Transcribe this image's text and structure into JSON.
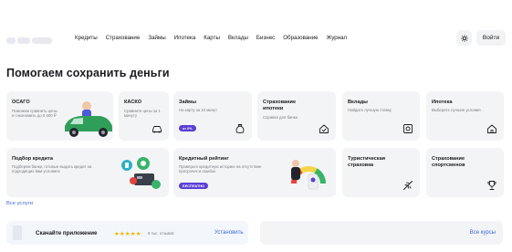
{
  "header": {
    "nav": [
      "Кредиты",
      "Страхование",
      "Займы",
      "Ипотека",
      "Карты",
      "Вклады",
      "Бизнес",
      "Образование",
      "Журнал"
    ],
    "theme_icon": "sun-icon",
    "login_label": "Войти"
  },
  "page_title": "Помогаем сохранить деньги",
  "cards": [
    {
      "title": "ОСАГО",
      "subtitle": "Поможем сравнить цены и сэкономить до 5 500 ₽"
    },
    {
      "title": "КАСКО",
      "subtitle": "Сравните цены за 1 минуту",
      "icon": "car-icon"
    },
    {
      "title": "Займы",
      "subtitle": "На карту за 10 минут",
      "badge": "от 0%",
      "icon": "bag-icon"
    },
    {
      "title": "Страхование ипотеки",
      "subtitle": "Справка для банка",
      "icon": "house-check-icon"
    },
    {
      "title": "Вклады",
      "subtitle": "Найдите лучшую ставку",
      "icon": "safe-icon"
    },
    {
      "title": "Ипотека",
      "subtitle": "Выберите лучшие условия",
      "icon": "house-icon"
    },
    {
      "title": "Подбор кредита",
      "subtitle": "Подберем банки, готовые выдать кредит на подходящих вам условиях"
    },
    {
      "title": "Кредитный рейтинг",
      "subtitle": "Проверьте кредитную историю на отсутствие просрочек и ошибок",
      "badge": "БЕСПЛАТНО"
    },
    {
      "title": "Туристическая страховка",
      "subtitle": "",
      "icon": "plane-icon"
    },
    {
      "title": "Страхование спортсменов",
      "subtitle": "",
      "icon": "trophy-icon"
    }
  ],
  "all_services_link": "Все услуги",
  "app_promo": {
    "download_label": "Скачайте приложение",
    "stars": "★★★★★",
    "reviews": "9 тыс. отзывов",
    "install_label": "Установить"
  },
  "courses": {
    "all_courses_label": "Все курсы"
  },
  "colors": {
    "card_bg": "#f3f4f6",
    "accent_link": "#3d6ad6",
    "badge_purple": "#5b3fd6",
    "star": "#f5b400"
  }
}
